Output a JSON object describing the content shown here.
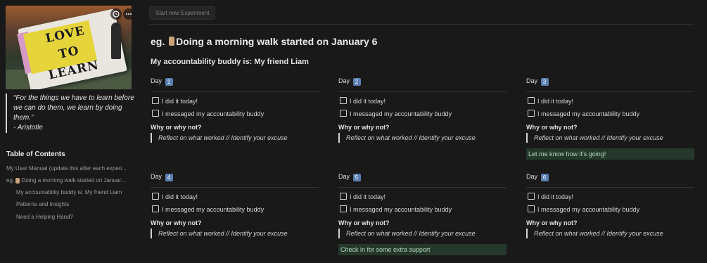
{
  "sidebar": {
    "cover": {
      "sign_line1": "LOVE TO",
      "sign_line2": "LEARN",
      "buttons": {
        "history_icon": "clock-icon",
        "more_icon": "ellipsis-icon"
      }
    },
    "quote": {
      "text": "“For the things we have to learn before we can do them, we learn by doing them.”",
      "author": "- Aristotle"
    },
    "toc": {
      "title": "Table of Contents",
      "items": [
        {
          "label": "My User Manual (update this after each experi..."
        },
        {
          "prefix": "eg.",
          "label": "Doing a morning walk started on Januar..."
        },
        {
          "label": "My accountability buddy is: My friend Liam"
        },
        {
          "label": "Patterns and Insights"
        },
        {
          "label": "Need a Helping Hand?"
        }
      ]
    }
  },
  "main": {
    "start_button": "Start new Experiment",
    "title_prefix": "eg.",
    "title": "Doing a morning walk started on January 6",
    "buddy_heading": "My accountability buddy is: My friend Liam",
    "days": [
      {
        "label": "Day",
        "num": "1",
        "tasks": [
          "I did it today!",
          "I messaged my accountability buddy"
        ],
        "why": "Why or why not?",
        "reflect": "Reflect on what worked // Identify your excuse",
        "callout": ""
      },
      {
        "label": "Day",
        "num": "2",
        "tasks": [
          "I did it today!",
          "I messaged my accountability buddy"
        ],
        "why": "Why or why not?",
        "reflect": "Reflect on what worked // Identify your excuse",
        "callout": ""
      },
      {
        "label": "Day",
        "num": "3",
        "tasks": [
          "I did it today!",
          "I messaged my accountability buddy"
        ],
        "why": "Why or why not?",
        "reflect": "Reflect on what worked // Identify your excuse",
        "callout": "Let me know how it's going!"
      },
      {
        "label": "Day",
        "num": "4",
        "tasks": [
          "I did it today!",
          "I messaged my accountability buddy"
        ],
        "why": "Why or why not?",
        "reflect": "Reflect on what worked // Identify your excuse",
        "callout": ""
      },
      {
        "label": "Day",
        "num": "5",
        "tasks": [
          "I did it today!",
          "I messaged my accountability buddy"
        ],
        "why": "Why or why not?",
        "reflect": "Reflect on what worked // Identify your excuse",
        "callout": "Check in for some extra support"
      },
      {
        "label": "Day",
        "num": "6",
        "tasks": [
          "I did it today!",
          "I messaged my accountability buddy"
        ],
        "why": "Why or why not?",
        "reflect": "Reflect on what worked // Identify your excuse",
        "callout": ""
      }
    ]
  },
  "colors": {
    "background": "#191919",
    "callout_bg": "#24392c",
    "day_badge": "#5a7fb0"
  }
}
